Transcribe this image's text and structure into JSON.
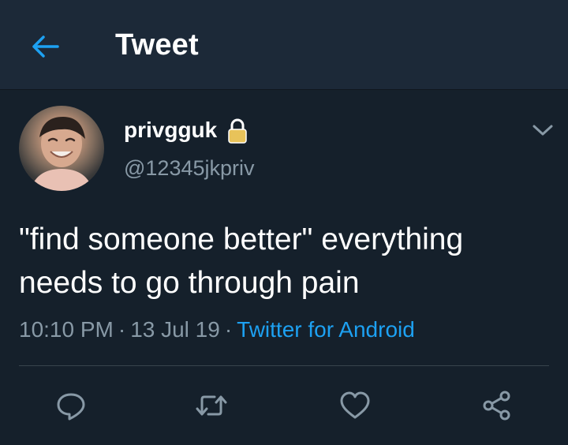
{
  "header": {
    "title": "Tweet",
    "back_icon": "arrow-left-icon",
    "accent": "#1da1f2",
    "background": "#1c2938"
  },
  "tweet": {
    "display_name": "privgguk",
    "handle": "@12345jkpriv",
    "protected_icon": "lock-icon",
    "menu_icon": "chevron-down-icon",
    "text": "\"find someone better\" everything needs to go through pain",
    "time": "10:10 PM",
    "separator": "·",
    "date": "13 Jul 19",
    "source": "Twitter for Android",
    "link_color": "#1da1f2",
    "secondary_color": "#8899a6"
  },
  "actions": [
    {
      "icon": "reply-icon"
    },
    {
      "icon": "retweet-icon"
    },
    {
      "icon": "like-heart-icon"
    },
    {
      "icon": "share-icon"
    }
  ],
  "theme": {
    "background": "#15202b",
    "divider": "#38444d"
  }
}
